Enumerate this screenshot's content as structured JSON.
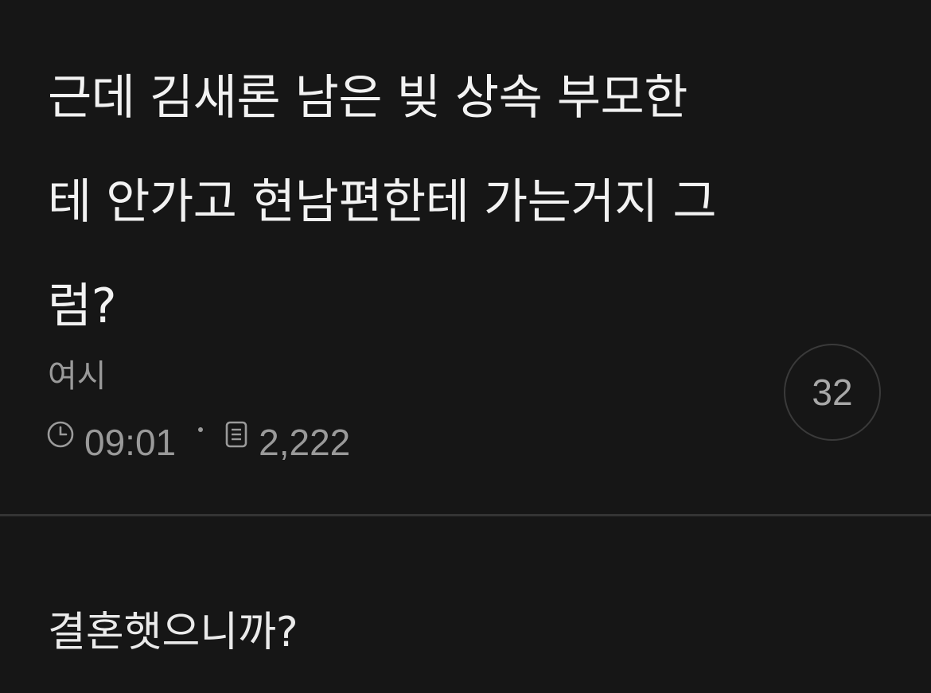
{
  "post": {
    "title": "근데 김새론 남은 빚 상속 부모한\n테 안가고 현남편한테 가는거지 그\n럼?",
    "author": "여시",
    "time": "09:01",
    "views": "2,222",
    "comment_count": "32",
    "body": "결혼햇으니까?"
  },
  "icons": {
    "time": "clock-icon",
    "views": "document-icon"
  },
  "colors": {
    "background": "#161616",
    "title_text": "#f2f2f2",
    "meta_text": "#9a9a9a",
    "divider": "#343434"
  }
}
